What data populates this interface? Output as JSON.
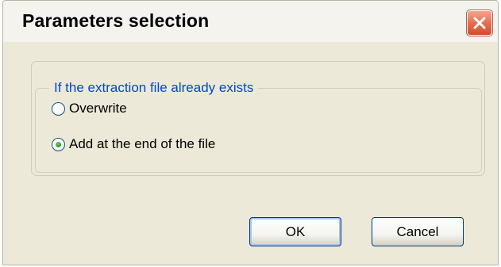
{
  "window": {
    "title": "Parameters selection"
  },
  "group": {
    "legend": "If the extraction file already exists",
    "options": [
      {
        "label": "Overwrite",
        "selected": false
      },
      {
        "label": "Add at the end of the file",
        "selected": true
      }
    ]
  },
  "buttons": {
    "ok_label": "OK",
    "cancel_label": "Cancel"
  },
  "icons": {
    "close": "close-icon",
    "radio": "radio-icon"
  },
  "colors": {
    "legend_text": "#0046d5",
    "close_button": "#e56a4e",
    "dialog_bg": "#ece9d8"
  }
}
